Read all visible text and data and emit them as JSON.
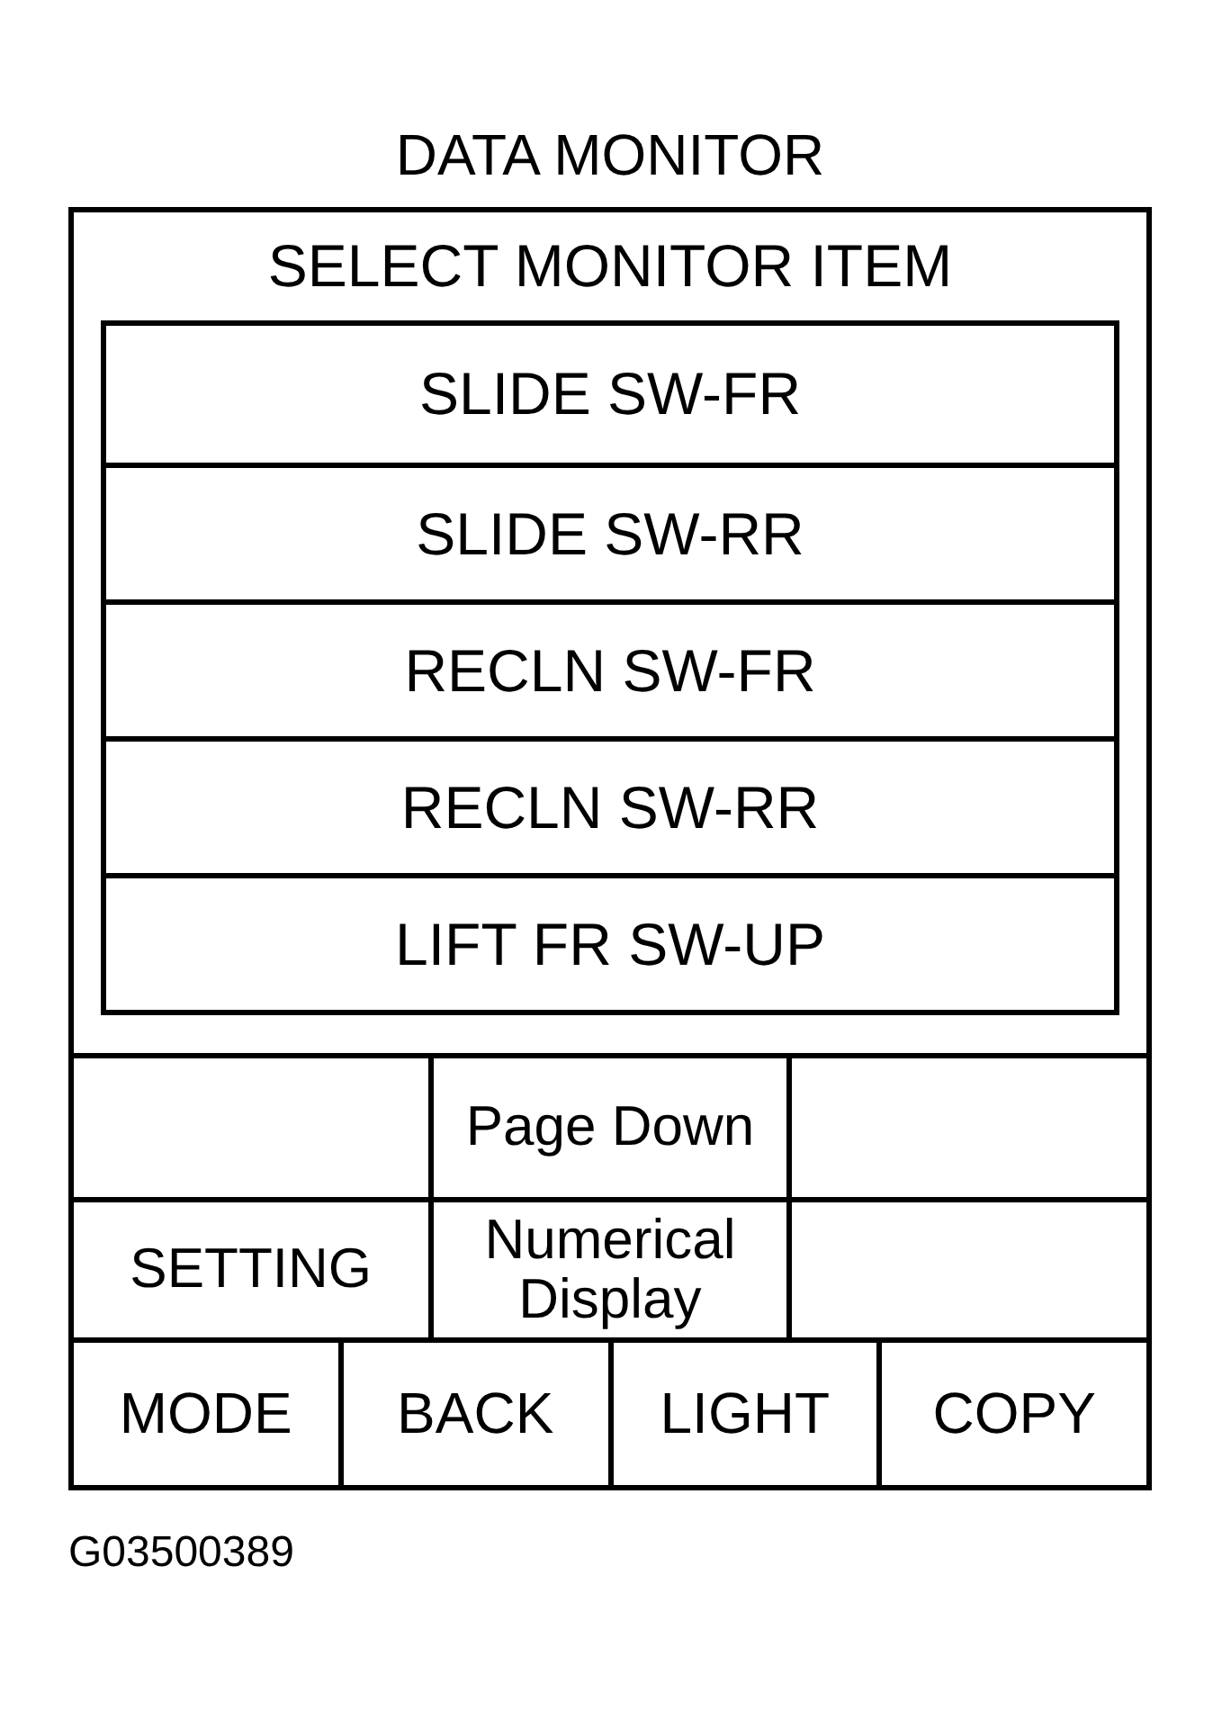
{
  "title": "DATA MONITOR",
  "screen": {
    "header": "SELECT MONITOR ITEM",
    "items": [
      {
        "label": "SLIDE SW-FR",
        "selected": false
      },
      {
        "label": "SLIDE SW-RR",
        "selected": false
      },
      {
        "label": "RECLN SW-FR",
        "selected": false
      },
      {
        "label": "RECLN SW-RR",
        "selected": false
      },
      {
        "label": "LIFT FR SW-UP",
        "selected": false
      }
    ]
  },
  "soft_keys": [
    [
      {
        "kind": "blank"
      },
      {
        "kind": "key",
        "label": "Page Down"
      },
      {
        "kind": "blank"
      }
    ],
    [
      {
        "kind": "key",
        "label": "SETTING"
      },
      {
        "kind": "key",
        "label": "Numerical Display"
      },
      {
        "kind": "blank"
      }
    ]
  ],
  "function_keys": [
    "MODE",
    "BACK",
    "LIGHT",
    "COPY"
  ],
  "figure_code": "G03500389"
}
